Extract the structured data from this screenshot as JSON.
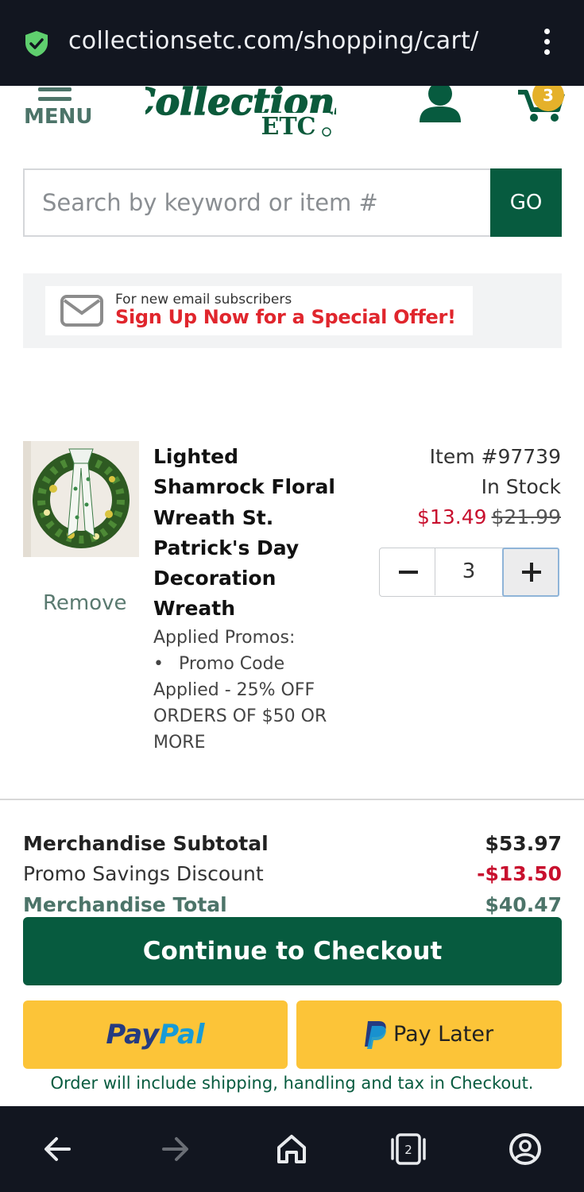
{
  "browser": {
    "url": "collectionsetc.com/shopping/cart/",
    "tab_count": "2"
  },
  "header": {
    "menu_label": "MENU",
    "cart_count": "3",
    "logo_alt": "Collections ETC"
  },
  "search": {
    "placeholder": "Search by keyword or item #",
    "go_label": "GO"
  },
  "promo_banner": {
    "small_text": "For new email subscribers",
    "big_text": "Sign Up Now for a Special Offer!"
  },
  "cart": {
    "item": {
      "title": "Lighted Shamrock Floral Wreath St. Patrick's Day Decoration Wreath",
      "item_number": "Item #97739",
      "stock": "In Stock",
      "sale_price": "$13.49",
      "original_price": "$21.99",
      "quantity": "3",
      "remove_label": "Remove",
      "promos_heading": "Applied Promos:",
      "promo_line_1": "Promo Code",
      "promo_line_2": "Applied - 25% OFF ORDERS OF $50 OR MORE"
    }
  },
  "summary": {
    "subtotal_label": "Merchandise Subtotal",
    "subtotal_value": "$53.97",
    "discount_label": "Promo Savings Discount",
    "discount_value": "-$13.50",
    "total_label": "Merchandise Total",
    "total_value": "$40.47"
  },
  "actions": {
    "checkout_label": "Continue to Checkout",
    "paypal_part1": "Pay",
    "paypal_part2": "Pal",
    "paylater_label": "Pay Later",
    "footnote": "Order will include shipping, handling and tax in Checkout."
  },
  "colors": {
    "brand_green": "#075b3f",
    "sale_red": "#c8102e",
    "paypal_yellow": "#fcc438",
    "badge_gold": "#e5b12a"
  }
}
